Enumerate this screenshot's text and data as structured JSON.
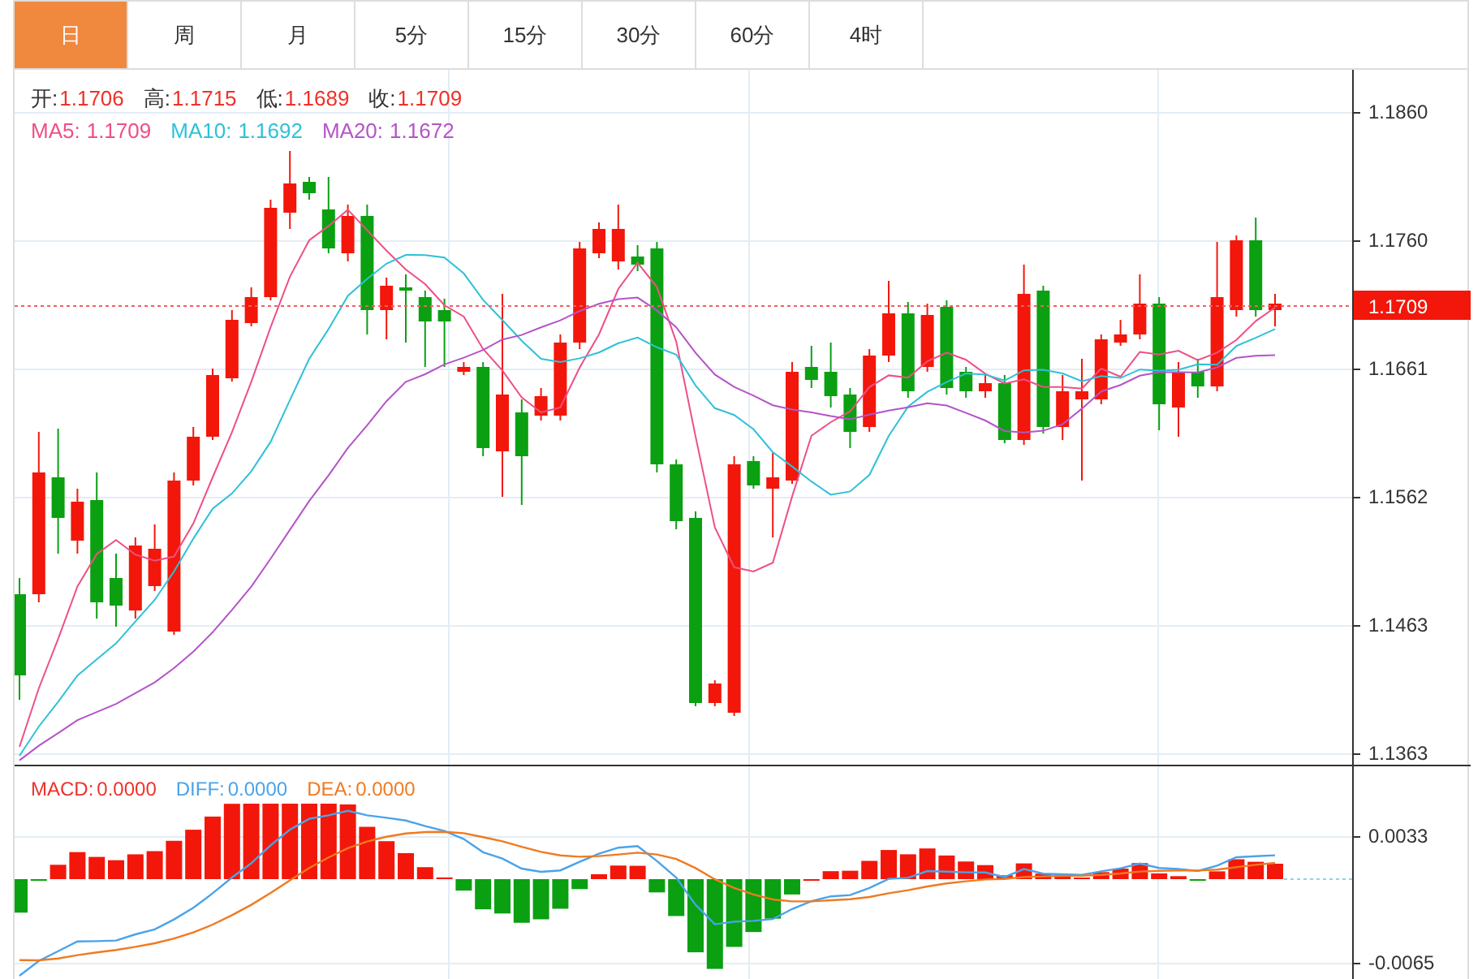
{
  "tabs": [
    {
      "label": "日",
      "selected": true
    },
    {
      "label": "周",
      "selected": false
    },
    {
      "label": "月",
      "selected": false
    },
    {
      "label": "5分",
      "selected": false
    },
    {
      "label": "15分",
      "selected": false
    },
    {
      "label": "30分",
      "selected": false
    },
    {
      "label": "60分",
      "selected": false
    },
    {
      "label": "4时",
      "selected": false
    }
  ],
  "ohlc_legend": [
    {
      "label": "开:",
      "value": "1.1706"
    },
    {
      "label": "高:",
      "value": "1.1715"
    },
    {
      "label": "低:",
      "value": "1.1689"
    },
    {
      "label": "收:",
      "value": "1.1709"
    }
  ],
  "ma_legend": [
    {
      "label": "MA5:",
      "value": "1.1709",
      "color": "#ee4f86"
    },
    {
      "label": "MA10:",
      "value": "1.1692",
      "color": "#2fc1d8"
    },
    {
      "label": "MA20:",
      "value": "1.1672",
      "color": "#b454c8"
    }
  ],
  "price_axis": [
    "1.1860",
    "1.1760",
    "1.1661",
    "1.1562",
    "1.1463",
    "1.1363"
  ],
  "current_price": "1.1709",
  "macd_legend": [
    {
      "label": "MACD:",
      "value": "0.0000",
      "color": "#f0302a"
    },
    {
      "label": "DIFF:",
      "value": "0.0000",
      "color": "#4aa3ea"
    },
    {
      "label": "DEA:",
      "value": "0.0000",
      "color": "#f07a20"
    }
  ],
  "macd_axis": [
    "0.0033",
    "-0.0065"
  ]
}
